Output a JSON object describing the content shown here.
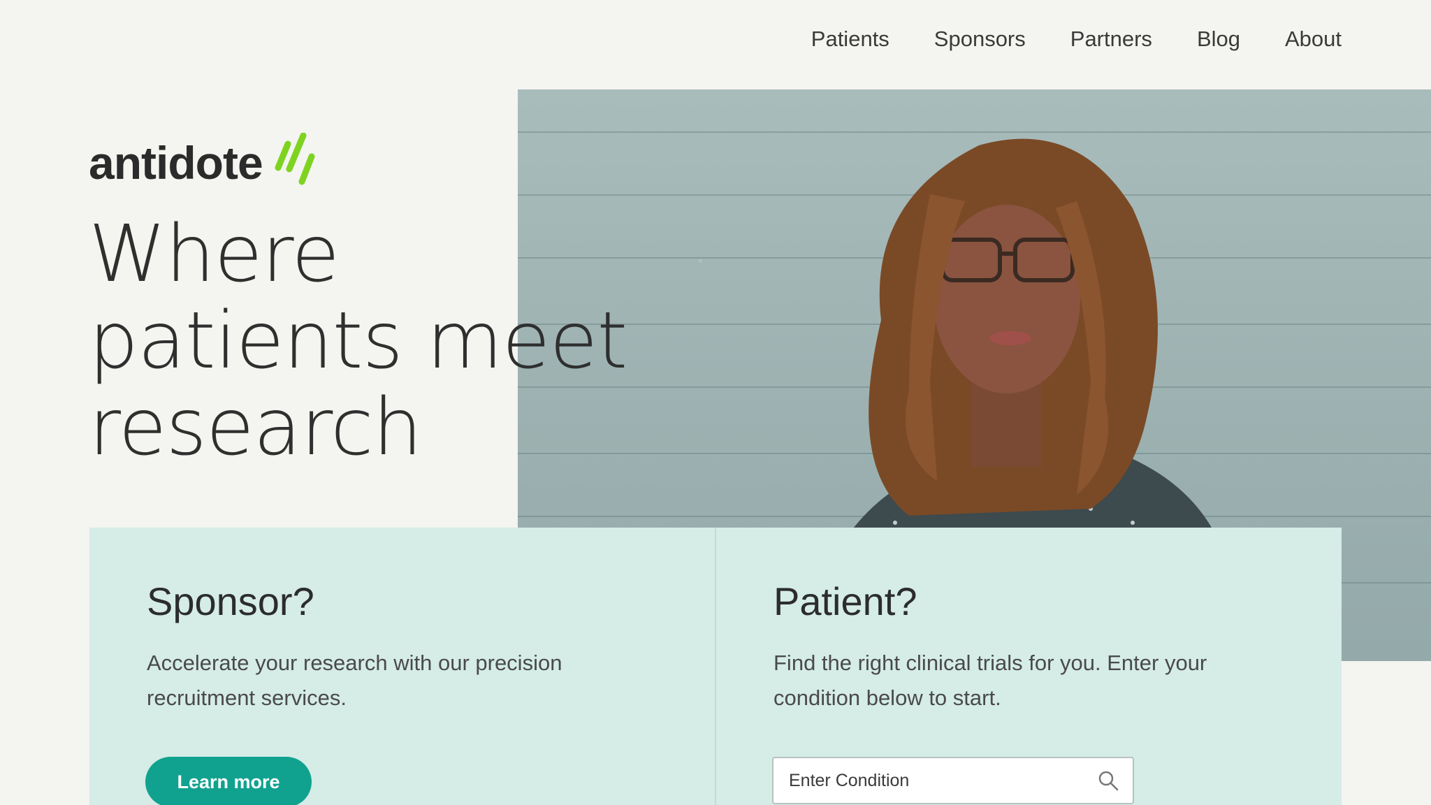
{
  "nav": {
    "items": [
      {
        "label": "Patients"
      },
      {
        "label": "Sponsors"
      },
      {
        "label": "Partners"
      },
      {
        "label": "Blog"
      },
      {
        "label": "About"
      }
    ]
  },
  "brand": {
    "name": "antidote",
    "accent_color": "#7ed321"
  },
  "hero": {
    "headline_lines": [
      "Where",
      "patients meet",
      "research"
    ]
  },
  "sponsor_card": {
    "title": "Sponsor?",
    "description": "Accelerate your research with our precision recruitment services.",
    "button_label": "Learn more",
    "button_color": "#11a28f"
  },
  "patient_card": {
    "title": "Patient?",
    "description": "Find the right clinical trials for you. Enter your condition below to start.",
    "search_placeholder": "Enter Condition",
    "search_icon": "search-icon"
  },
  "colors": {
    "page_background": "#f4f4f0",
    "card_background": "#d5ece7",
    "text_dark": "#2f2f2f"
  }
}
